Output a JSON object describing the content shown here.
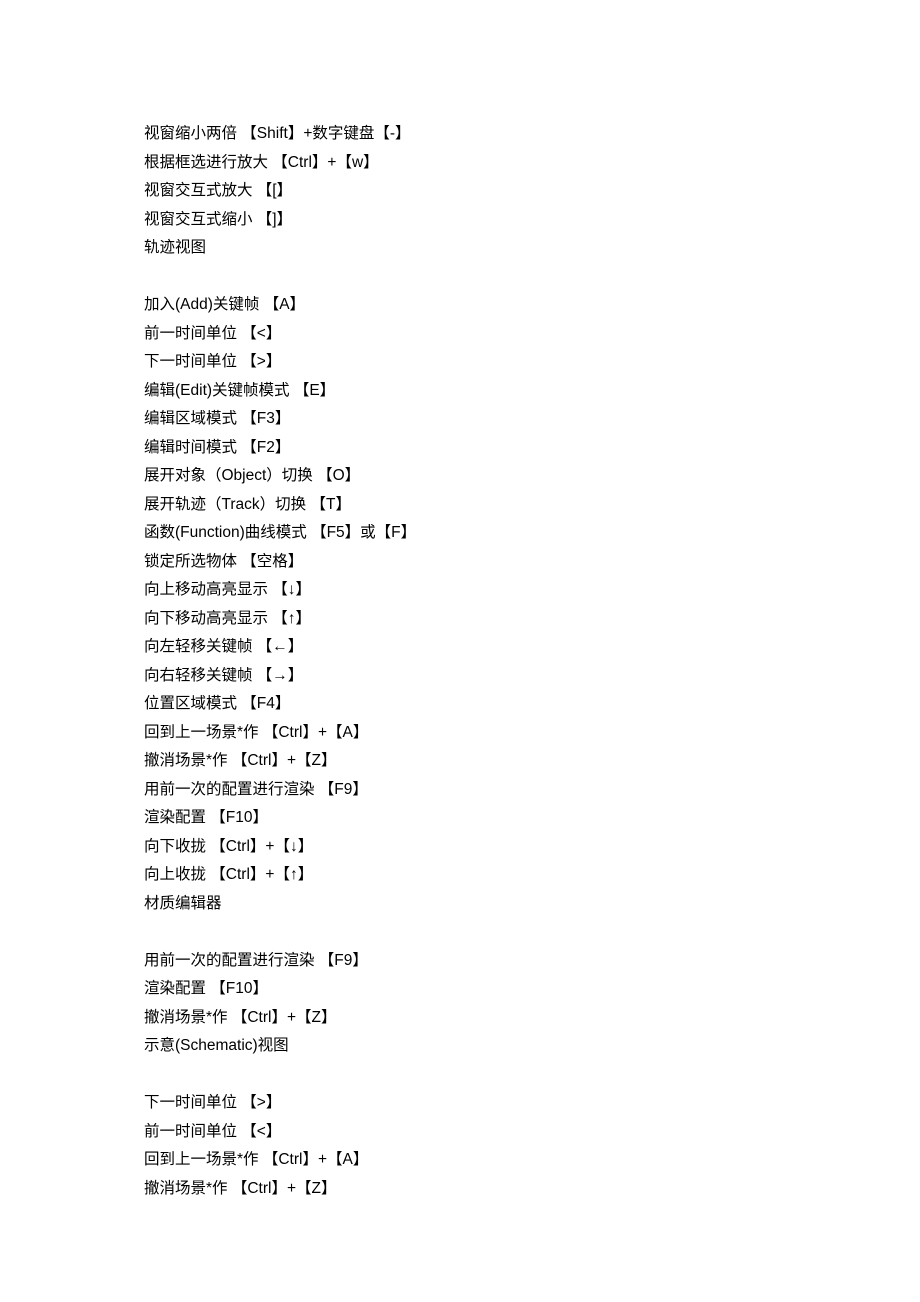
{
  "lines": [
    "视窗缩小两倍 【Shift】+数字键盘【-】",
    "根据框选进行放大 【Ctrl】+【w】",
    "视窗交互式放大 【[】",
    "视窗交互式缩小 【]】",
    "轨迹视图",
    "",
    "加入(Add)关键帧 【A】",
    "前一时间单位 【<】",
    "下一时间单位 【>】",
    "编辑(Edit)关键帧模式 【E】",
    "编辑区域模式 【F3】",
    "编辑时间模式 【F2】",
    "展开对象（Object）切换 【O】",
    "展开轨迹（Track）切换 【T】",
    "函数(Function)曲线模式 【F5】或【F】",
    "锁定所选物体 【空格】",
    "向上移动高亮显示 【↓】",
    "向下移动高亮显示 【↑】",
    "向左轻移关键帧 【←】",
    "向右轻移关键帧 【→】",
    "位置区域模式 【F4】",
    "回到上一场景*作 【Ctrl】+【A】",
    "撤消场景*作 【Ctrl】+【Z】",
    "用前一次的配置进行渲染 【F9】",
    "渲染配置 【F10】",
    "向下收拢 【Ctrl】+【↓】",
    "向上收拢 【Ctrl】+【↑】",
    "材质编辑器",
    "",
    "用前一次的配置进行渲染 【F9】",
    "渲染配置 【F10】",
    "撤消场景*作 【Ctrl】+【Z】",
    "示意(Schematic)视图",
    "",
    "下一时间单位 【>】",
    "前一时间单位 【<】",
    "回到上一场景*作 【Ctrl】+【A】",
    "撤消场景*作 【Ctrl】+【Z】"
  ]
}
